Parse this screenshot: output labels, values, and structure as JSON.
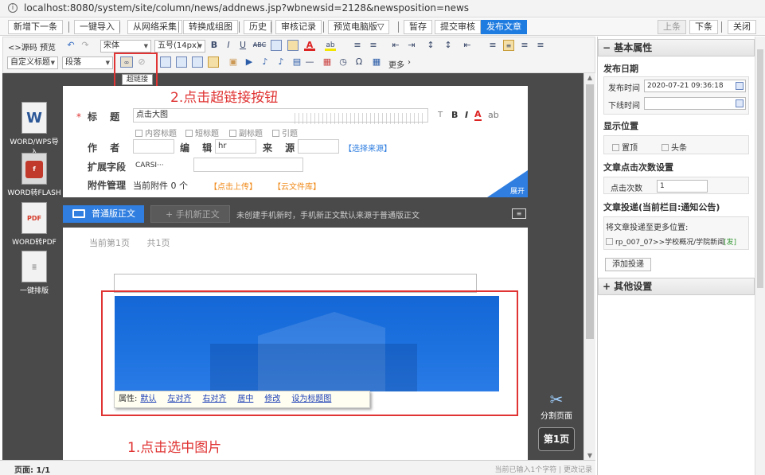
{
  "browser": {
    "url": "localhost:8080/system/site/column/news/addnews.jsp?wbnewsid=2128&newsposition=news",
    "info_icon": "i"
  },
  "actionbar": {
    "new_next": "新增下一条",
    "one_click_import": "一键导入",
    "web_collect": "从网络采集",
    "to_group_image": "转换成组图",
    "history": "历史",
    "audit_log": "审核记录",
    "preview_pc": "预览电脑版▽",
    "save_draft": "暂存",
    "submit_audit": "提交审核",
    "publish": "发布文章",
    "prev": "上条",
    "next": "下条",
    "close": "关闭"
  },
  "toolbar": {
    "source": "<>源码",
    "preview": "预览",
    "font_family": "宋体",
    "font_size": "五号(14px)",
    "custom_heading": "自定义标题",
    "paragraph": "段落",
    "more": "更多",
    "hyperlink_tooltip": "超链接",
    "glyphs": {
      "undo": "↶",
      "redo": "↷",
      "bold": "B",
      "italic": "I",
      "underline": "U",
      "strike": "ABC",
      "font_color": "A",
      "highlight": "ab",
      "ol": "≡",
      "ul": "≡",
      "indent": "⇥",
      "outdent": "⇤",
      "line_spacing": "↕",
      "align_l": "≡",
      "align_c": "≡",
      "align_r": "≡",
      "align_j": "≡",
      "link": "∞",
      "unlink": "⊘",
      "img": "▣",
      "video": "▶",
      "audio": "♪",
      "file": "▤",
      "hr": "—",
      "date": "▦",
      "time": "◷",
      "omega": "Ω",
      "table": "▦",
      "chev": "›"
    }
  },
  "sidebar_tools": [
    {
      "label": "WORD/WPS导入",
      "icon_glyph": "W"
    },
    {
      "label": "WORD转FLASH",
      "icon_glyph": "f"
    },
    {
      "label": "WORD转PDF",
      "icon_glyph": "PDF"
    },
    {
      "label": "一键排版",
      "icon_glyph": "≣"
    }
  ],
  "form": {
    "required_mark": "*",
    "title_label": "标 题",
    "title_value": "点击大图",
    "title_tools": {
      "t": "T",
      "b": "B",
      "i": "I",
      "a": "A"
    },
    "sub_opts": [
      "内容标题",
      "短标题",
      "副标题",
      "引题"
    ],
    "author_label": "作 者",
    "editor_label": "编 辑",
    "editor_value": "hr",
    "source_label": "来 源",
    "select_source": "【选择来源】",
    "ext_label": "扩展字段",
    "ext_value": "CARSI···",
    "attach_label": "附件管理",
    "attach_count": "当前附件 0 个",
    "upload": "【点击上传】",
    "cloud": "【云文件库】",
    "expand": "展开"
  },
  "editor_tabs": {
    "normal": "普通版正文",
    "mobile": "+ 手机新正文",
    "note": "未创建手机新时，手机新正文默认来源于普通版正文",
    "row_icon": "≡"
  },
  "editor": {
    "current_page": "当前第1页",
    "total_pages": "共1页",
    "attr_label": "属性:",
    "attr_links": [
      "默认",
      "左对齐",
      "右对齐",
      "居中",
      "修改",
      "设为标题图"
    ],
    "split_page": "分割页面",
    "split_icon": "✂",
    "page1": "第1页"
  },
  "annotations": {
    "step1": "1.点击选中图片",
    "step2": "2.点击超链接按钮"
  },
  "status": {
    "page": "页面:   1/1",
    "chars": "当前已输入1个字符 | 更改记录"
  },
  "right_panel": {
    "basic_props": "基本属性",
    "pub_date": "发布日期",
    "pub_time_label": "发布时间",
    "pub_time_value": "2020-07-21 09:36:18",
    "offline_label": "下线时间",
    "display_pos": "显示位置",
    "pin_top": "置顶",
    "headline": "头条",
    "click_setting": "文章点击次数设置",
    "click_label": "点击次数",
    "click_value": "1",
    "delivery": "文章投递(当前栏目:通知公告)",
    "delivery_more": "将文章投递至更多位置:",
    "delivery_item": "rp_007_07>>学校概况/学院新闻",
    "delivery_tag": "[发]",
    "add_delivery": "添加投递",
    "other_settings": "其他设置",
    "collapse_glyph": "−",
    "expand_glyph": "+"
  },
  "colors": {
    "primary": "#1e7be0",
    "annotation": "#e03333",
    "dark_bg": "#4a4a4a",
    "orange": "#f08a1a"
  }
}
